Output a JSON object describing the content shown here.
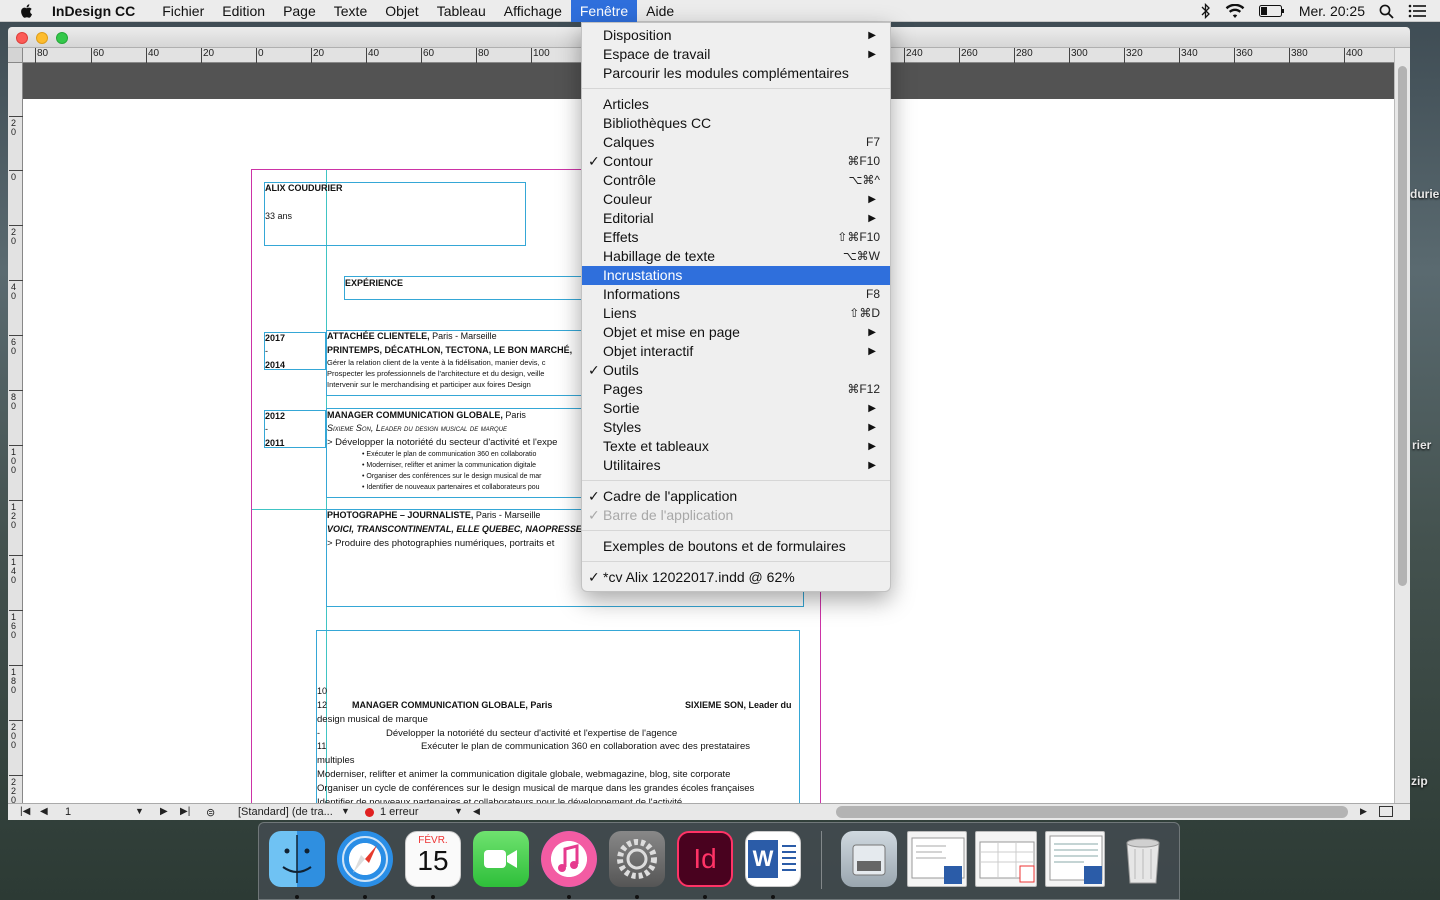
{
  "menubar": {
    "app_name": "InDesign CC",
    "items": [
      "Fichier",
      "Edition",
      "Page",
      "Texte",
      "Objet",
      "Tableau",
      "Affichage",
      "Fenêtre",
      "Aide"
    ],
    "active_item": "Fenêtre",
    "clock": "Mer. 20:25"
  },
  "desktop_labels": [
    "durier",
    "rier",
    "zip"
  ],
  "ruler": {
    "top_ticks": [
      "80",
      "60",
      "40",
      "20",
      "0",
      "20",
      "40",
      "60",
      "80",
      "100",
      "240",
      "260",
      "280",
      "300",
      "320",
      "340",
      "360",
      "380",
      "400"
    ],
    "left_ticks": [
      "20",
      "0",
      "20",
      "40",
      "60",
      "80",
      "100",
      "120",
      "140",
      "160",
      "180",
      "200",
      "220"
    ]
  },
  "document": {
    "name": "ALIX COUDURIER",
    "age": "33 ans",
    "section_experience": "EXPÉRIENCE",
    "job1": {
      "years_start": "2017",
      "years_dash": "-",
      "years_end": "2014",
      "title": "ATTACHÉE CLIENTELE,",
      "location": " Paris - Marseille",
      "companies": "PRINTEMPS, DÉCATHLON, TECTONA, LE BON MARCHÉ,",
      "lines": [
        "Gérer la relation client de la vente à la fidélisation, manier devis, c",
        "Prospecter les professionnels de l'architecture et du design, veille",
        "Intervenir sur le merchandising et  participer aux foires Design"
      ]
    },
    "job2": {
      "years_start": "2012",
      "years_dash": "-",
      "years_end": "2011",
      "title": "MANAGER COMMUNICATION GLOBALE,",
      "location": " Paris",
      "company": "Sixieme Son, Leader du design musical de marque",
      "headline": "> Développer la notoriété du secteur d'activité et l'expe",
      "bullets": [
        "• Exécuter le plan de communication 360 en collaboratio",
        "• Moderniser, relifter et animer la communication digitale",
        "• Organiser des conférences sur le design musical de mar",
        "• Identifier de nouveaux partenaires et collaborateurs pou"
      ]
    },
    "job3": {
      "title": "PHOTOGRAPHE – JOURNALISTE,",
      "location": " Paris - Marseille",
      "companies": "VOICI, TRANSCONTINENTAL, ELLE QUEBEC, NAOPRESSE",
      "headline": "> Produire des photographies numériques, portraits et"
    },
    "overflow": {
      "l1": "10",
      "l2a": "12",
      "l2b": "MANAGER COMMUNICATION GLOBALE, Paris",
      "l2c": "SIXIEME SON, Leader du",
      "l3": "design musical de marque",
      "l4a": "-",
      "l4b": "Développer la notoriété du secteur d'activité et l'expertise de l'agence",
      "l5a": "11",
      "l5b": "Exécuter le plan de communication 360 en collaboration avec des prestataires",
      "l6": "multiples",
      "l7": "Moderniser, relifter et animer la communication digitale globale, webmagazine, blog, site corporate",
      "l8": "Organiser un cycle de conférences sur le design musical de marque dans les grandes écoles françaises",
      "l9": "Identifier de nouveaux partenaires et collaborateurs pour le développement de l'activité"
    }
  },
  "fenetre_menu": {
    "items": [
      {
        "label": "Disposition",
        "submenu": true
      },
      {
        "label": "Espace de travail",
        "submenu": true
      },
      {
        "label": "Parcourir les modules complémentaires"
      },
      {
        "sep": true
      },
      {
        "label": "Articles"
      },
      {
        "label": "Bibliothèques CC"
      },
      {
        "label": "Calques",
        "shortcut": "F7"
      },
      {
        "label": "Contour",
        "checked": true,
        "shortcut": "⌘F10"
      },
      {
        "label": "Contrôle",
        "shortcut": "⌥⌘^"
      },
      {
        "label": "Couleur",
        "submenu": true
      },
      {
        "label": "Editorial",
        "submenu": true
      },
      {
        "label": "Effets",
        "shortcut": "⇧⌘F10"
      },
      {
        "label": "Habillage de texte",
        "shortcut": "⌥⌘W"
      },
      {
        "label": "Incrustations",
        "highlighted": true
      },
      {
        "label": "Informations",
        "shortcut": "F8"
      },
      {
        "label": "Liens",
        "shortcut": "⇧⌘D"
      },
      {
        "label": "Objet et mise en page",
        "submenu": true
      },
      {
        "label": "Objet interactif",
        "submenu": true
      },
      {
        "label": "Outils",
        "checked": true
      },
      {
        "label": "Pages",
        "shortcut": "⌘F12"
      },
      {
        "label": "Sortie",
        "submenu": true
      },
      {
        "label": "Styles",
        "submenu": true
      },
      {
        "label": "Texte et tableaux",
        "submenu": true
      },
      {
        "label": "Utilitaires",
        "submenu": true
      },
      {
        "sep": true
      },
      {
        "label": "Cadre de l'application",
        "checked": true
      },
      {
        "label": "Barre de l'application",
        "checked": true,
        "disabled": true
      },
      {
        "sep": true
      },
      {
        "label": "Exemples de boutons et de formulaires"
      },
      {
        "sep": true
      },
      {
        "label": "*cv Alix 12022017.indd @ 62%",
        "checked": true
      }
    ]
  },
  "statusbar": {
    "page_number": "1",
    "style": "[Standard] (de tra...",
    "errors": "1 erreur"
  },
  "dock": {
    "calendar_month": "FÉVR.",
    "calendar_day": "15",
    "indesign_label": "Id",
    "word_label": "W"
  },
  "colors": {
    "menu_highlight": "#2f6fdc",
    "page_margin": "#cc33a6",
    "frame_border": "#35a7d6",
    "guide": "#40c4c4"
  }
}
